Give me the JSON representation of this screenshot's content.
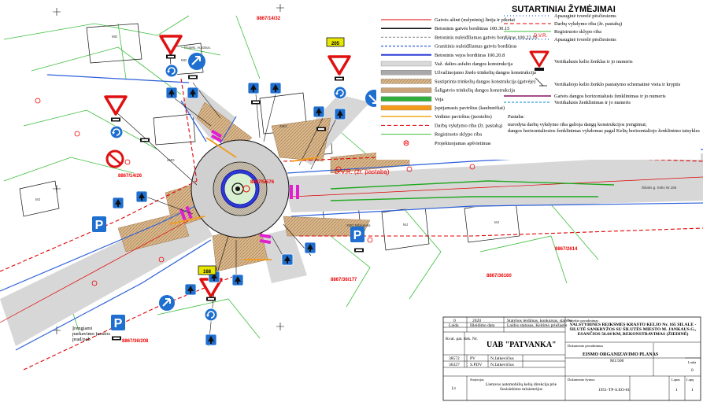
{
  "legend": {
    "title": "SUTARTINIAI ŽYMĖJIMAI",
    "left_items": [
      "Gatvės ašinė (nulyninių) linija ir piketai",
      "Betoninis gatvės bordiūras 100.30.15",
      "Betoninis nuleidžiamas gatvės bordiūras 100.22.15",
      "Granitinis nuleidžiamas gatvės bordiūras",
      "Betoninis vejos bordiūras 100.20.8",
      "Važ. dalies asfalto dangos konstrukcija",
      "Užvažiuojamo žiedo trinkelių dangos konstrukcija",
      "Sustiprinta trinkelių dangos konstrukcija (gatvėje)",
      "Šaligatvio trinkelių dangos konstrukcija",
      "Veja",
      "Įspėjamasis paviršius (kauburėliai)",
      "Vedimo paviršius (juostelės)",
      "Darbų vykdymo riba (žr. pastabą)",
      "Registruoto sklypo riba",
      "Projektuojamas apšvietimas"
    ],
    "right_items": [
      "Apsauginė tvorelė pėsčiesiems",
      "Darbų vykdymo riba (žr. pastabą)",
      "Registruoto sklypo riba",
      "Apsauginė tvorelė pėsčiesiems",
      "Vertikalusis kelio ženklas ir jo numeris",
      "Vertikaliojo kelio ženklo pastatymo schematinė vieta ir kryptis",
      "Gatvės dangos horizontalusis ženklinimas ir jo numeris",
      "Vertikalusis ženklinimas ir jo numeris"
    ],
    "dvr_abbr": "D.V.R.",
    "note_title": "Pastaba:",
    "note_lines": [
      "nurodyta darbų vykdymo riba galioja dangų konstrukcijos įrengimui;",
      "dangos horizontaliosios ženklinimas vykdomas pagal Kelių horizontaliojo ženklinimo taisykles"
    ]
  },
  "map_labels": {
    "dvr": "D.V.R. (žr. pastabą)",
    "parcel_top": "8867/14/32",
    "parcel_mid_left": "8867/14/26",
    "parcel_center": "8867/5/576",
    "parcel_right": "8867/2614",
    "parcel_bottom": "8867/36160",
    "parcel_bottom_mid": "8867/36/177",
    "parcel_bottom_left": "8867/36/208",
    "sign_205": "205",
    "sign_168": "168",
    "mg": "MG",
    "zmg": "2MG",
    "mj": "MJ",
    "parking_note": "Įrengiami parkavimo juostos prad/pab",
    "bus_note": "Projekt. Autobus.",
    "road_label": "Šilutės g. Kelio Nr.165",
    "center_label": "2MG Biblioteka"
  },
  "title_block": {
    "rev_no": "0",
    "rev_year": "2020",
    "rev_desc": "Statybos leidimas, konkursas, statyba",
    "col_laida": "Laida",
    "col_data": "Išleidimo data",
    "col_status": "Laidos statusas, Keitimo priežastis",
    "col_kval": "Kval. pat. dok. Nr.",
    "company": "UAB \"PATVANKA\"",
    "row1_no": "38572",
    "row1_role": "PV",
    "row1_name": "N.Jatkevičius",
    "row2_no": "36327",
    "row2_role": "S.PDV",
    "row2_name": "N.Jatkevičius",
    "lt": "Lt",
    "client_label": "Statytojas",
    "client": "Lietuvos automobilių kelių direkcija prie Susisiekimo ministerijos",
    "object_label": "Projekto pavadinimas",
    "object": "VALSTYBINĖS REIKŠMĖS KRAŠTO KELIO Nr. 165 ŠILALĖ - ŠILUTĖ SANKRYŽOS SU ŠILUTĖS MIESTO M. JANKAUS G., ESANČIOS 56.64 KM, REKONSTRAVIMAS (ŽIEDINĖ)",
    "doc_label": "Dokumento pavadinimas",
    "doc_title": "EISMO ORGANIZAVIMO PLANAS",
    "scale": "M1:500",
    "laida_label": "Laida",
    "laida_value": "0",
    "doc_no_label": "Dokumento žymuo",
    "doc_no": "1951-TP-S.EO-01",
    "sheet_label": "Lapas",
    "sheets_label": "Lapų",
    "sheet": "1",
    "sheets": "1"
  },
  "colors": {
    "road": "#cfcfcf",
    "ring_fill": "#bfb6a6",
    "paving": "#e5c49a",
    "sign_blue": "#1e6fd0",
    "sign_red": "#e01010",
    "grass": "#2fae3b",
    "dvr_red": "#e00000"
  }
}
